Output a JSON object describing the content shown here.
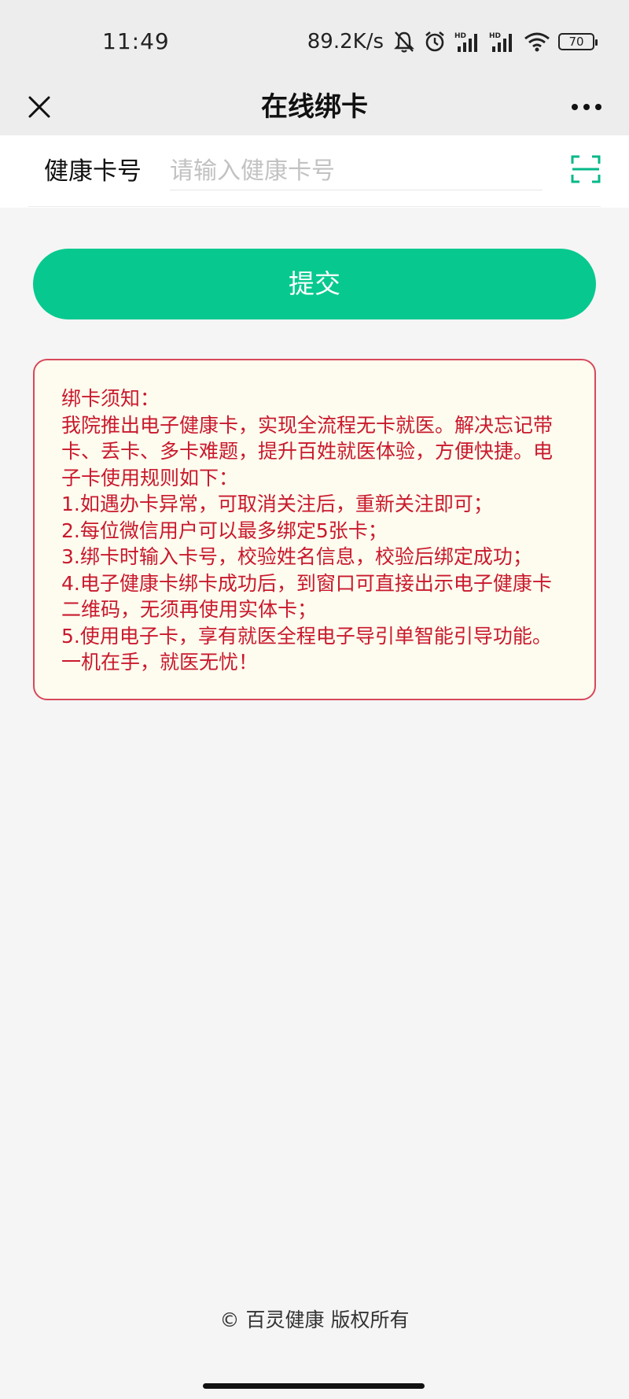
{
  "status_bar": {
    "time": "11:49",
    "net_speed": "89.2K/s",
    "battery": "70",
    "icons": [
      "mute-bell-icon",
      "alarm-icon",
      "hd-signal-icon",
      "hd-signal-icon",
      "wifi-icon",
      "battery-icon"
    ]
  },
  "nav": {
    "title": "在线绑卡",
    "close_icon": "close-icon",
    "more_icon": "more-icon"
  },
  "form": {
    "card_label": "健康卡号",
    "card_placeholder": "请输入健康卡号",
    "card_value": "",
    "scan_icon": "scan-icon",
    "submit_label": "提交"
  },
  "notice": {
    "title": "绑卡须知：",
    "intro": "我院推出电子健康卡，实现全流程无卡就医。解决忘记带卡、丢卡、多卡难题，提升百姓就医体验，方便快捷。电子卡使用规则如下：",
    "rules": [
      "1.如遇办卡异常，可取消关注后，重新关注即可；",
      "2.每位微信用户可以最多绑定5张卡；",
      "3.绑卡时输入卡号，校验姓名信息，校验后绑定成功；",
      "4.电子健康卡绑卡成功后，到窗口可直接出示电子健康卡二维码，无须再使用实体卡；",
      "5.使用电子卡，享有就医全程电子导引单智能引导功能。一机在手，就医无忧！"
    ]
  },
  "footer": {
    "copyright": "© 百灵健康 版权所有"
  },
  "colors": {
    "accent": "#07c98f",
    "notice_text": "#c9192c",
    "notice_border": "#d7485a",
    "notice_bg": "#fdfcef"
  }
}
